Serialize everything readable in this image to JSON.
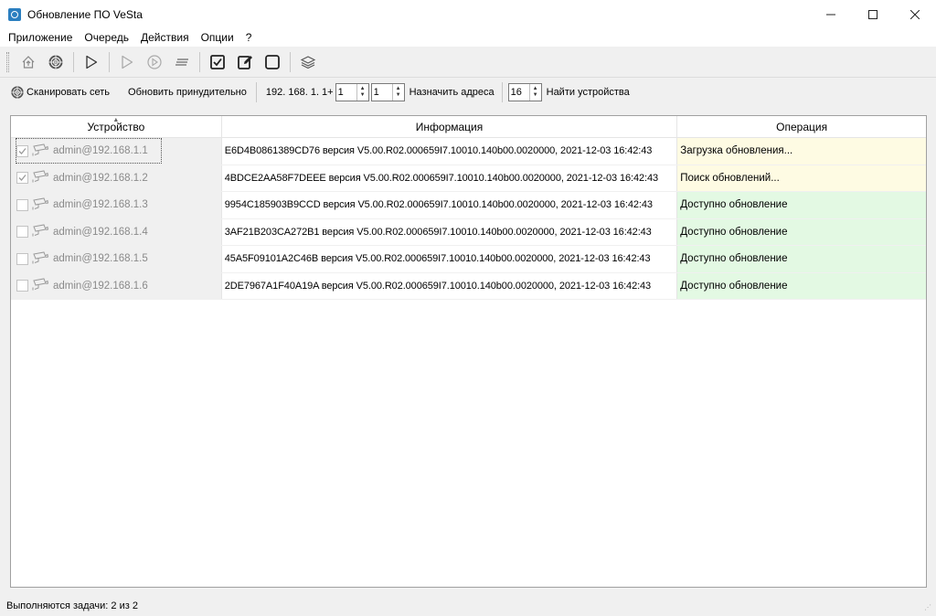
{
  "window": {
    "title": "Обновление ПО VeSta"
  },
  "menu": [
    "Приложение",
    "Очередь",
    "Действия",
    "Опции",
    "?"
  ],
  "toolbar": {
    "icons": [
      "home-upload-icon",
      "radar-icon",
      "play-icon",
      "play-disabled-icon",
      "play-circle-icon",
      "lines-icon",
      "check-all-icon",
      "edit-icon",
      "uncheck-all-icon",
      "layers-icon"
    ]
  },
  "scanbar": {
    "scan_label": "Сканировать сеть",
    "force_update_label": "Обновить принудительно",
    "ip_prefix": "192. 168. 1. 1+",
    "spin1_value": "1",
    "spin2_value": "1",
    "assign_label": "Назначить адреса",
    "spin3_value": "16",
    "find_label": "Найти устройства"
  },
  "table": {
    "columns": [
      "Устройство",
      "Информация",
      "Операция"
    ],
    "rows": [
      {
        "device": "admin@192.168.1.1",
        "checked": true,
        "info": "E6D4B0861389CD76 версия V5.00.R02.000659I7.10010.140b00.0020000, 2021-12-03 16:42:43",
        "operation": "Загрузка обновления...",
        "status": "busy"
      },
      {
        "device": "admin@192.168.1.2",
        "checked": true,
        "info": "4BDCE2AA58F7DEEE версия V5.00.R02.000659I7.10010.140b00.0020000, 2021-12-03 16:42:43",
        "operation": "Поиск обновлений...",
        "status": "busy"
      },
      {
        "device": "admin@192.168.1.3",
        "checked": false,
        "info": "9954C185903B9CCD версия V5.00.R02.000659I7.10010.140b00.0020000, 2021-12-03 16:42:43",
        "operation": "Доступно обновление",
        "status": "available"
      },
      {
        "device": "admin@192.168.1.4",
        "checked": false,
        "info": "3AF21B203CA272B1 версия V5.00.R02.000659I7.10010.140b00.0020000, 2021-12-03 16:42:43",
        "operation": "Доступно обновление",
        "status": "available"
      },
      {
        "device": "admin@192.168.1.5",
        "checked": false,
        "info": "45A5F09101A2C46B версия V5.00.R02.000659I7.10010.140b00.0020000, 2021-12-03 16:42:43",
        "operation": "Доступно обновление",
        "status": "available"
      },
      {
        "device": "admin@192.168.1.6",
        "checked": false,
        "info": "2DE7967A1F40A19A версия V5.00.R02.000659I7.10010.140b00.0020000, 2021-12-03 16:42:43",
        "operation": "Доступно обновление",
        "status": "available"
      }
    ]
  },
  "colors": {
    "busy": "#fefbe3",
    "available": "#e3f9e3"
  },
  "status": {
    "text": "Выполняются задачи: 2 из 2"
  }
}
